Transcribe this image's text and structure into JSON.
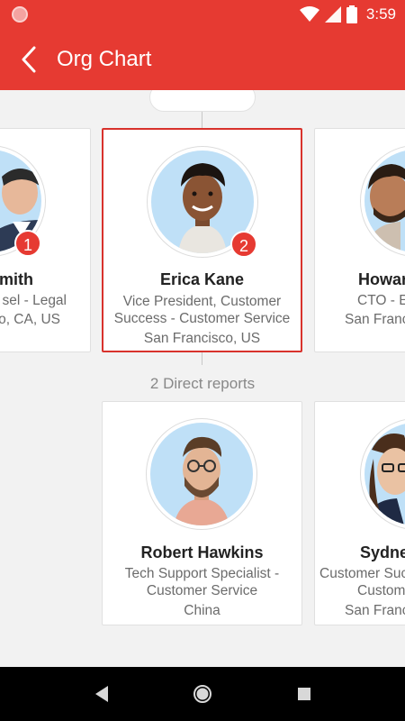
{
  "status_bar": {
    "time": "3:59"
  },
  "app_bar": {
    "title": "Org Chart"
  },
  "managers": [
    {
      "name": "mith",
      "role_line1": "sel - Legal",
      "location": "co, CA, US",
      "badge": "1"
    },
    {
      "name": "Erica Kane",
      "role_line1": "Vice President, Customer",
      "role_line2": "Success - Customer Service",
      "location": "San Francisco, US",
      "badge": "2"
    },
    {
      "name": "Howar",
      "role_line1": "CTO - E",
      "location": "San Franc"
    }
  ],
  "direct_reports_label": "2 Direct reports",
  "reports": [
    {
      "name": "Robert Hawkins",
      "role_line1": "Tech Support Specialist -",
      "role_line2": "Customer Service",
      "location": "China"
    },
    {
      "name": "Sydne",
      "role_line1": "Customer Suc",
      "role_line2": "Custom",
      "location": "San Franc"
    }
  ],
  "colors": {
    "accent": "#e63a32",
    "selected_border": "#d8322c",
    "avatar_bg": "#bfe0f7"
  },
  "icons": [
    "back-arrow-icon",
    "wifi-icon",
    "signal-icon",
    "battery-icon",
    "nav-back-icon",
    "nav-home-icon",
    "nav-recents-icon"
  ]
}
